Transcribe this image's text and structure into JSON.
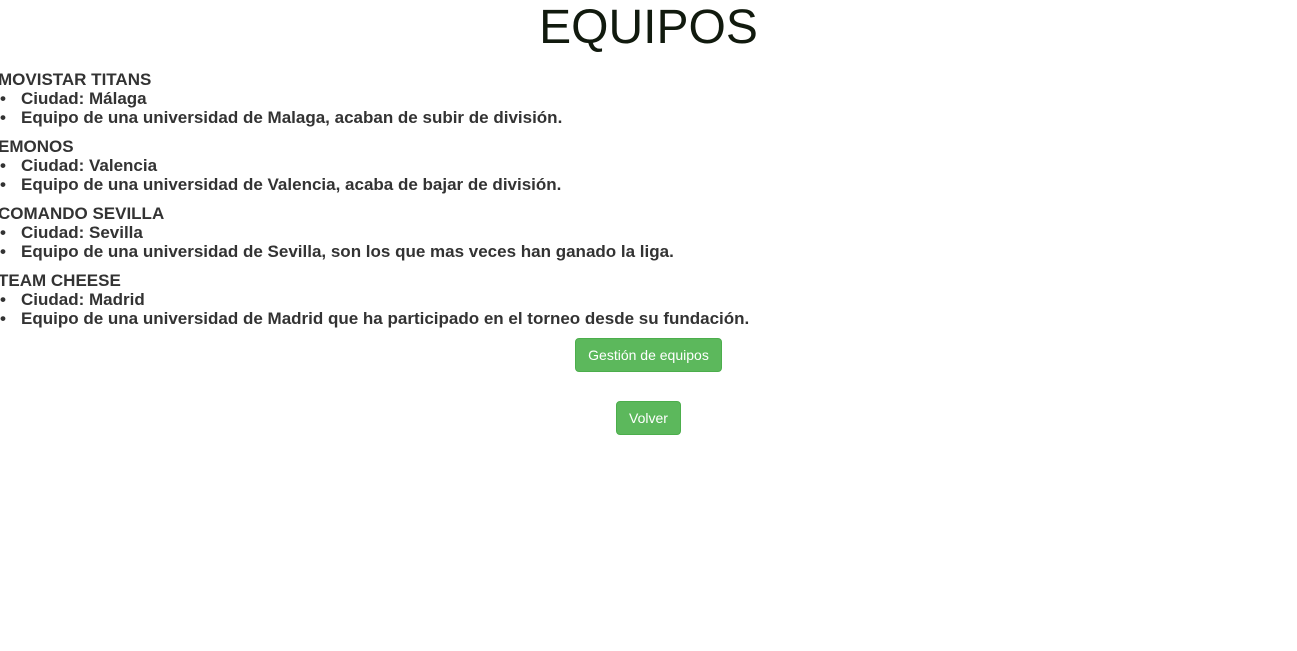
{
  "page": {
    "title": "EQUIPOS"
  },
  "teams": [
    {
      "name": "MOVISTAR TITANS",
      "city": "Ciudad: Málaga",
      "description": "Equipo de una universidad de Malaga, acaban de subir de división."
    },
    {
      "name": "EMONOS",
      "city": "Ciudad: Valencia",
      "description": "Equipo de una universidad de Valencia, acaba de bajar de división."
    },
    {
      "name": "COMANDO SEVILLA",
      "city": "Ciudad: Sevilla",
      "description": "Equipo de una universidad de Sevilla, son los que mas veces han ganado la liga."
    },
    {
      "name": "TEAM CHEESE",
      "city": "Ciudad: Madrid",
      "description": "Equipo de una universidad de Madrid que ha participado en el torneo desde su fundación."
    }
  ],
  "buttons": {
    "manage_label": "Gestión de equipos",
    "back_label": "Volver"
  },
  "colors": {
    "button_green": "#5cb85c",
    "text": "#333333"
  }
}
